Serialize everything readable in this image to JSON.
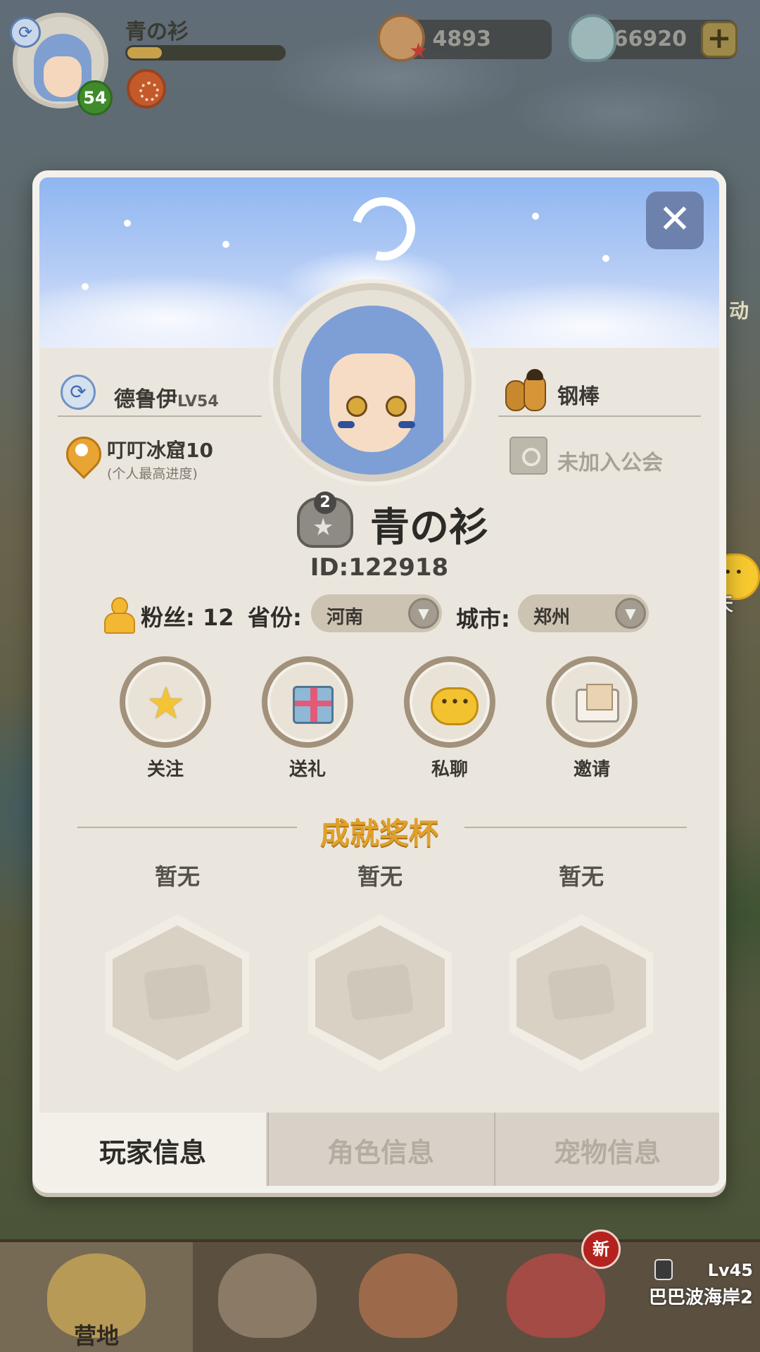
{
  "hud": {
    "player_name": "青の衫",
    "level": "54",
    "exp_fraction": 0.22,
    "currency_shells": "4893",
    "currency_gems": "66920",
    "plus": "+"
  },
  "side": {
    "chat_label": "聊天",
    "clip_right": "动"
  },
  "dialog": {
    "close_label": "✕",
    "class_name": "德鲁伊",
    "class_level": "LV54",
    "progress_main": "叮叮冰窟10",
    "progress_sub": "(个人最高进度)",
    "weapon": "钢棒",
    "guild": "未加入公会",
    "rank_num": "2",
    "player_name": "青の衫",
    "player_id": "ID:122918",
    "fans_label": "粉丝: 12",
    "province_label": "省份:",
    "province_value": "河南",
    "city_label": "城市:",
    "city_value": "郑州",
    "actions": [
      {
        "label": "关注"
      },
      {
        "label": "送礼"
      },
      {
        "label": "私聊"
      },
      {
        "label": "邀请"
      }
    ],
    "trophy_title": "成就奖杯",
    "trophies": [
      {
        "label": "暂无"
      },
      {
        "label": "暂无"
      },
      {
        "label": "暂无"
      }
    ],
    "tabs": [
      {
        "label": "玩家信息"
      },
      {
        "label": "角色信息"
      },
      {
        "label": "宠物信息"
      }
    ]
  },
  "bottom_nav": {
    "camp_label": "营地",
    "new_badge": "新",
    "lock_level": "Lv45",
    "lock_place": "巴巴波海岸2"
  }
}
